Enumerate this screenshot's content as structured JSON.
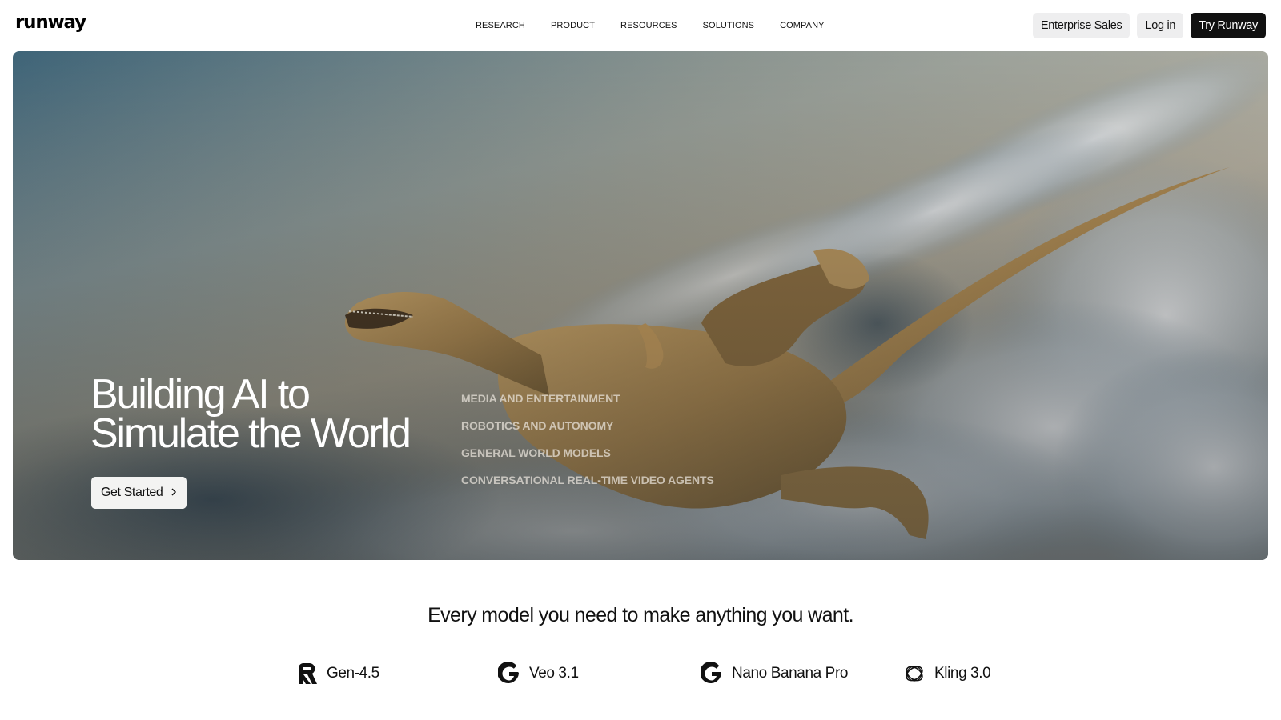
{
  "header": {
    "logo": "runway",
    "nav": [
      "RESEARCH",
      "PRODUCT",
      "RESOURCES",
      "SOLUTIONS",
      "COMPANY"
    ],
    "enterprise_label": "Enterprise Sales",
    "login_label": "Log in",
    "try_label": "Try Runway"
  },
  "hero": {
    "title_line1": "Building AI to",
    "title_line2": "Simulate the World",
    "cta_label": "Get Started",
    "categories": [
      "MEDIA AND ENTERTAINMENT",
      "ROBOTICS AND AUTONOMY",
      "GENERAL WORLD MODELS",
      "CONVERSATIONAL REAL-TIME VIDEO AGENTS"
    ]
  },
  "models_section": {
    "tagline": "Every model you need to make anything you want.",
    "models": [
      {
        "label": "Gen-4.5",
        "icon": "runway-r-icon"
      },
      {
        "label": "Veo 3.1",
        "icon": "google-g-icon"
      },
      {
        "label": "Nano Banana Pro",
        "icon": "google-g-icon"
      },
      {
        "label": "Kling 3.0",
        "icon": "kling-icon"
      }
    ]
  },
  "colors": {
    "primary_button": "#111111",
    "secondary_button": "#eeeeef",
    "hero_text": "#ffffff"
  }
}
